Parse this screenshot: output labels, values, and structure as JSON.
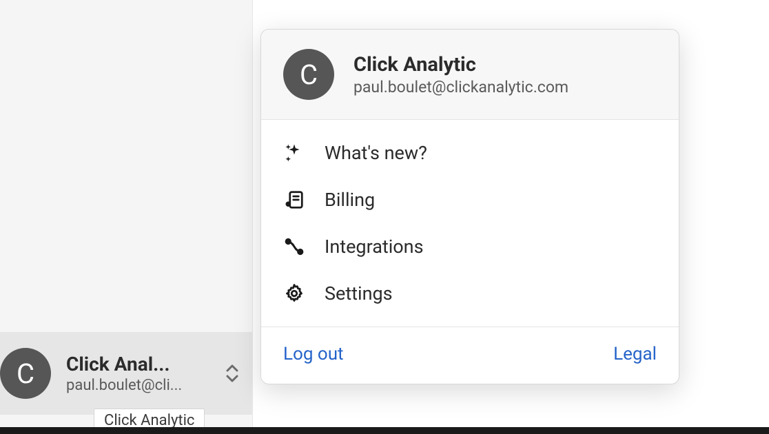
{
  "account": {
    "name": "Click Analytic",
    "email": "paul.boulet@clickanalytic.com",
    "avatar_letter": "C",
    "sidebar_name_truncated": "Click Anal...",
    "sidebar_email_truncated": "paul.boulet@cli..."
  },
  "tooltip": {
    "text": "Click Analytic"
  },
  "menu": {
    "items": [
      {
        "label": "What's new?",
        "icon": "sparkles-icon"
      },
      {
        "label": "Billing",
        "icon": "billing-icon"
      },
      {
        "label": "Integrations",
        "icon": "integrations-icon"
      },
      {
        "label": "Settings",
        "icon": "gear-icon"
      }
    ]
  },
  "footer": {
    "logout": "Log out",
    "legal": "Legal"
  }
}
